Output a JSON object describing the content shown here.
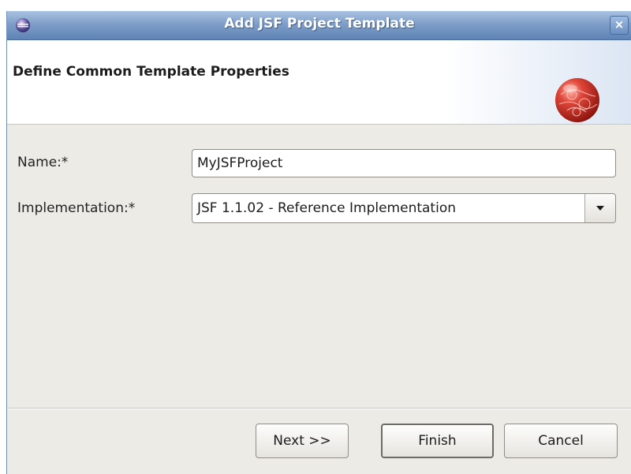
{
  "window": {
    "title": "Add JSF Project Template",
    "close_glyph": "×",
    "app_icon": "eclipse-icon"
  },
  "banner": {
    "title": "Define Common Template Properties",
    "logo_icon": "red-globe-icon"
  },
  "form": {
    "name_label": "Name:*",
    "name_value": "MyJSFProject",
    "implementation_label": "Implementation:*",
    "implementation_value": "JSF 1.1.02 - Reference Implementation"
  },
  "buttons": {
    "next": "Next >>",
    "finish": "Finish",
    "cancel": "Cancel"
  },
  "colors": {
    "titlebar": "#7f9ec8",
    "dialog_bg": "#ecebe6",
    "logo_red": "#c8261e"
  }
}
